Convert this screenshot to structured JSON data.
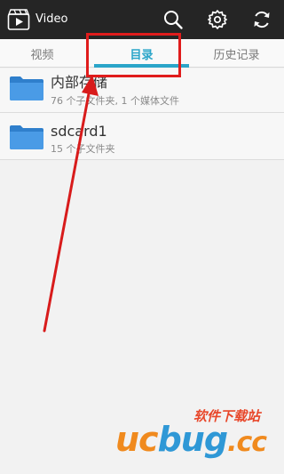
{
  "app": {
    "title": "Video"
  },
  "tabs": [
    {
      "label": "视频"
    },
    {
      "label": "目录"
    },
    {
      "label": "历史记录"
    }
  ],
  "folders": [
    {
      "name": "内部存储",
      "meta": "76 个子文件夹, 1 个媒体文件"
    },
    {
      "name": "sdcard1",
      "meta": "15 个子文件夹"
    }
  ],
  "watermark": {
    "chinese": "软件下载站",
    "logo_uc": "uc",
    "logo_bug": "bug",
    "logo_cc": ".cc"
  },
  "colors": {
    "topbar": "#252525",
    "accent": "#2aa5c9",
    "folder": "#3b8fd8",
    "annotation": "#e01c1c"
  },
  "icons": {
    "app": "video-clapper-icon",
    "search": "search-icon",
    "settings": "gear-icon",
    "refresh": "refresh-icon",
    "folder": "folder-icon"
  }
}
